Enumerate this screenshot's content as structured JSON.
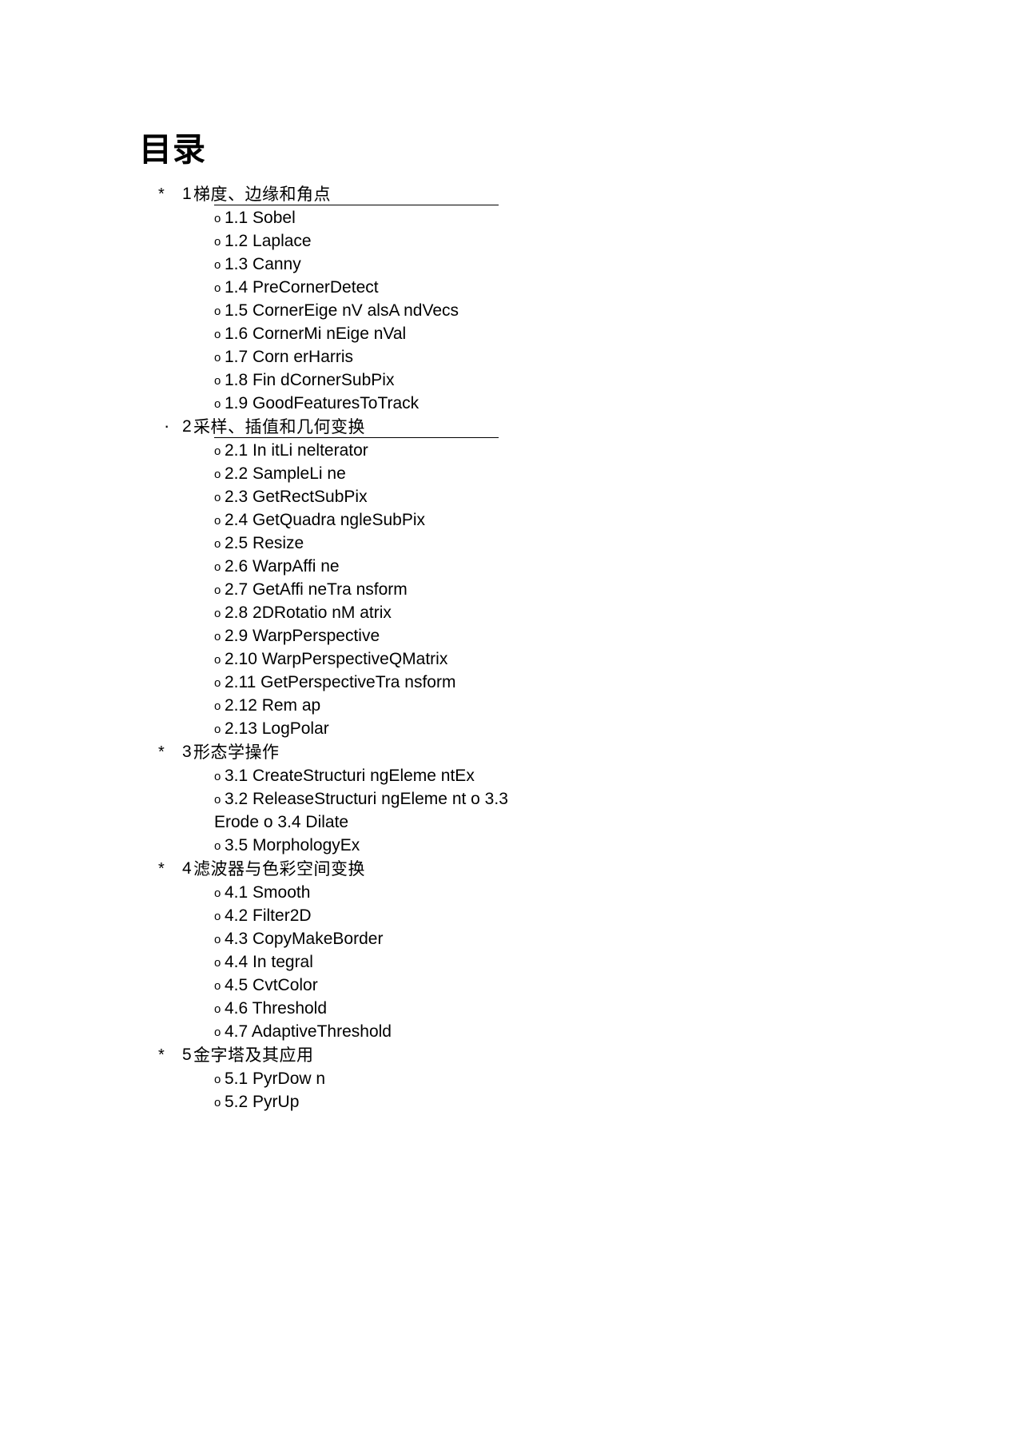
{
  "document": {
    "title": "目录"
  },
  "toc": {
    "sections": [
      {
        "bullet": "*",
        "bullet_kind": "star",
        "number": "1",
        "text": "梯度、边缘和角点",
        "rule": true,
        "entries": [
          {
            "bullet": "o",
            "label": "1.1 Sobel"
          },
          {
            "bullet": "o",
            "label": "1.2 Laplace"
          },
          {
            "bullet": "o",
            "label": "1.3 Canny"
          },
          {
            "bullet": "o",
            "label": "1.4 PreCornerDetect"
          },
          {
            "bullet": "o",
            "label": "1.5 CornerEige nV alsA ndVecs"
          },
          {
            "bullet": "o",
            "label": "1.6 CornerMi nEige nVal"
          },
          {
            "bullet": "o",
            "label": "1.7 Corn erHarris"
          },
          {
            "bullet": "o",
            "label": "1.8 Fin dCornerSubPix"
          },
          {
            "bullet": "o",
            "label": "1.9 GoodFeaturesToTrack"
          }
        ]
      },
      {
        "bullet": "·",
        "bullet_kind": "dot",
        "number": "2",
        "text": "采样、插值和几何变换",
        "rule": true,
        "entries": [
          {
            "bullet": "o",
            "label": "2.1 In itLi nelterator"
          },
          {
            "bullet": "o",
            "label": "2.2 SampleLi ne"
          },
          {
            "bullet": "o",
            "label": "2.3 GetRectSubPix"
          },
          {
            "bullet": "o",
            "label": "2.4 GetQuadra ngleSubPix"
          },
          {
            "bullet": "o",
            "label": "2.5 Resize"
          },
          {
            "bullet": "o",
            "label": "2.6 WarpAffi ne"
          },
          {
            "bullet": "o",
            "label": "2.7 GetAffi neTra nsform"
          },
          {
            "bullet": "o",
            "label": "2.8 2DRotatio nM atrix"
          },
          {
            "bullet": "o",
            "label": "2.9 WarpPerspective"
          },
          {
            "bullet": "o",
            "label": "2.10 WarpPerspectiveQMatrix"
          },
          {
            "bullet": "o",
            "label": "2.11 GetPerspectiveTra nsform"
          },
          {
            "bullet": "o",
            "label": "2.12 Rem ap"
          },
          {
            "bullet": "o",
            "label": "2.13 LogPolar"
          }
        ]
      },
      {
        "bullet": "*",
        "bullet_kind": "star",
        "number": "3",
        "text": "形态学操作",
        "rule": false,
        "entries": [
          {
            "bullet": "o",
            "label": "3.1 CreateStructuri ngEleme ntEx"
          },
          {
            "bullet": "o",
            "label": "3.2 ReleaseStructuri ngEleme nt o 3.3"
          },
          {
            "bullet": "",
            "label": "Erode o 3.4 Dilate"
          },
          {
            "bullet": "o",
            "label": "3.5 MorphologyEx"
          }
        ]
      },
      {
        "bullet": "*",
        "bullet_kind": "star",
        "number": "4",
        "text": "滤波器与色彩空间变换",
        "rule": false,
        "entries": [
          {
            "bullet": "o",
            "label": "4.1 Smooth"
          },
          {
            "bullet": "o",
            "label": "4.2 Filter2D"
          },
          {
            "bullet": "o",
            "label": "4.3 CopyMakeBorder"
          },
          {
            "bullet": "o",
            "label": "4.4 In tegral"
          },
          {
            "bullet": "o",
            "label": "4.5 CvtColor"
          },
          {
            "bullet": "o",
            "label": "4.6 Threshold"
          },
          {
            "bullet": "o",
            "label": "4.7 AdaptiveThreshold"
          }
        ]
      },
      {
        "bullet": "*",
        "bullet_kind": "star",
        "number": "5",
        "text": "金字塔及其应用",
        "rule": false,
        "entries": [
          {
            "bullet": "o",
            "label": "5.1 PyrDow n"
          },
          {
            "bullet": "o",
            "label": "5.2 PyrUp"
          }
        ]
      }
    ]
  }
}
